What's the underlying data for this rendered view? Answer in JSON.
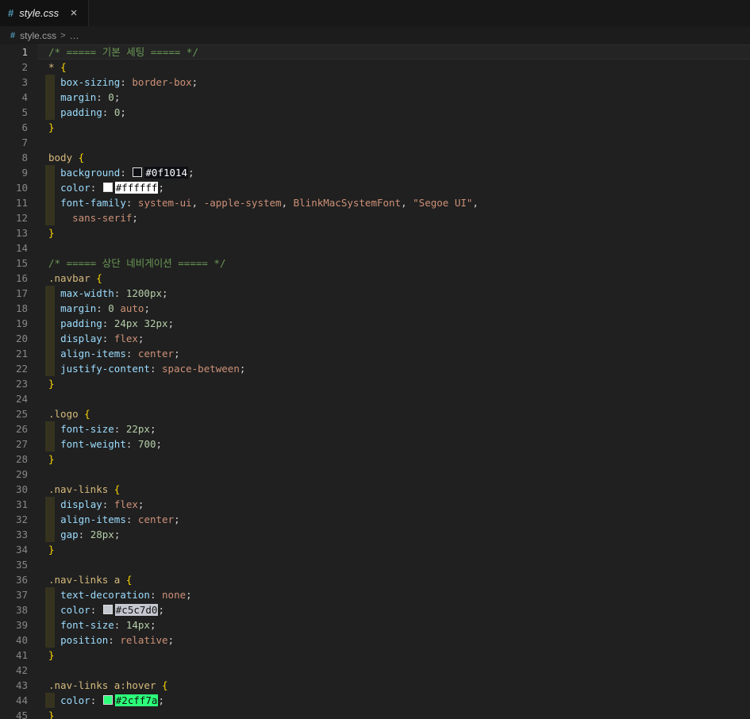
{
  "tab": {
    "title": "style.css",
    "icon_glyph": "#",
    "close_glyph": "×"
  },
  "breadcrumb": {
    "icon_glyph": "#",
    "file": "style.css",
    "separator": ">",
    "ellipsis": "…"
  },
  "theme": {
    "editor_bg": "#202020",
    "tabbar_bg": "#181818",
    "active_tab_bg": "#121212",
    "breadcrumb_bg": "#1c1c1c",
    "css_icon_blue": "#519aba",
    "comment_green": "#6a9955",
    "selector_gold": "#d7ba7d",
    "brace_gold": "#ffd700",
    "property_blue": "#9cdcfe",
    "value_tan": "#ce9178",
    "number_green": "#b5cea8",
    "guide_olive": "#35331f"
  },
  "editor": {
    "active_line": 1,
    "lines": [
      {
        "n": 1,
        "t": [
          [
            "cm",
            "/* ===== 기본 세팅 ===== */"
          ]
        ]
      },
      {
        "n": 2,
        "t": [
          [
            "sel",
            "*"
          ],
          [
            "pn",
            " "
          ],
          [
            "br",
            "{"
          ]
        ]
      },
      {
        "n": 3,
        "g": 1,
        "t": [
          [
            "pn",
            "  "
          ],
          [
            "prop",
            "box-sizing"
          ],
          [
            "pn",
            ": "
          ],
          [
            "val",
            "border-box"
          ],
          [
            "pn",
            ";"
          ]
        ]
      },
      {
        "n": 4,
        "g": 1,
        "t": [
          [
            "pn",
            "  "
          ],
          [
            "prop",
            "margin"
          ],
          [
            "pn",
            ": "
          ],
          [
            "num",
            "0"
          ],
          [
            "pn",
            ";"
          ]
        ]
      },
      {
        "n": 5,
        "g": 1,
        "t": [
          [
            "pn",
            "  "
          ],
          [
            "prop",
            "padding"
          ],
          [
            "pn",
            ": "
          ],
          [
            "num",
            "0"
          ],
          [
            "pn",
            ";"
          ]
        ]
      },
      {
        "n": 6,
        "t": [
          [
            "br",
            "}"
          ]
        ]
      },
      {
        "n": 7,
        "t": []
      },
      {
        "n": 8,
        "t": [
          [
            "sel",
            "body"
          ],
          [
            "pn",
            " "
          ],
          [
            "br",
            "{"
          ]
        ]
      },
      {
        "n": 9,
        "g": 1,
        "t": [
          [
            "pn",
            "  "
          ],
          [
            "prop",
            "background"
          ],
          [
            "pn",
            ": "
          ],
          [
            "chip",
            "#0f1014",
            "#ffffff"
          ],
          [
            "pn",
            ";"
          ]
        ]
      },
      {
        "n": 10,
        "g": 1,
        "t": [
          [
            "pn",
            "  "
          ],
          [
            "prop",
            "color"
          ],
          [
            "pn",
            ": "
          ],
          [
            "chip",
            "#ffffff",
            "#000000"
          ],
          [
            "pn",
            ";"
          ]
        ]
      },
      {
        "n": 11,
        "g": 1,
        "t": [
          [
            "pn",
            "  "
          ],
          [
            "prop",
            "font-family"
          ],
          [
            "pn",
            ": "
          ],
          [
            "val",
            "system-ui"
          ],
          [
            "pn",
            ", "
          ],
          [
            "val",
            "-apple-system"
          ],
          [
            "pn",
            ", "
          ],
          [
            "val",
            "BlinkMacSystemFont"
          ],
          [
            "pn",
            ", "
          ],
          [
            "str",
            "\"Segoe UI\""
          ],
          [
            "pn",
            ","
          ]
        ]
      },
      {
        "n": 12,
        "g": 1,
        "t": [
          [
            "pn",
            "    "
          ],
          [
            "val",
            "sans-serif"
          ],
          [
            "pn",
            ";"
          ]
        ]
      },
      {
        "n": 13,
        "t": [
          [
            "br",
            "}"
          ]
        ]
      },
      {
        "n": 14,
        "t": []
      },
      {
        "n": 15,
        "t": [
          [
            "cm",
            "/* ===== 상단 네비게이션 ===== */"
          ]
        ]
      },
      {
        "n": 16,
        "t": [
          [
            "sel",
            ".navbar"
          ],
          [
            "pn",
            " "
          ],
          [
            "br",
            "{"
          ]
        ]
      },
      {
        "n": 17,
        "g": 1,
        "t": [
          [
            "pn",
            "  "
          ],
          [
            "prop",
            "max-width"
          ],
          [
            "pn",
            ": "
          ],
          [
            "num",
            "1200px"
          ],
          [
            "pn",
            ";"
          ]
        ]
      },
      {
        "n": 18,
        "g": 1,
        "t": [
          [
            "pn",
            "  "
          ],
          [
            "prop",
            "margin"
          ],
          [
            "pn",
            ": "
          ],
          [
            "num",
            "0"
          ],
          [
            "pn",
            " "
          ],
          [
            "val",
            "auto"
          ],
          [
            "pn",
            ";"
          ]
        ]
      },
      {
        "n": 19,
        "g": 1,
        "t": [
          [
            "pn",
            "  "
          ],
          [
            "prop",
            "padding"
          ],
          [
            "pn",
            ": "
          ],
          [
            "num",
            "24px"
          ],
          [
            "pn",
            " "
          ],
          [
            "num",
            "32px"
          ],
          [
            "pn",
            ";"
          ]
        ]
      },
      {
        "n": 20,
        "g": 1,
        "t": [
          [
            "pn",
            "  "
          ],
          [
            "prop",
            "display"
          ],
          [
            "pn",
            ": "
          ],
          [
            "val",
            "flex"
          ],
          [
            "pn",
            ";"
          ]
        ]
      },
      {
        "n": 21,
        "g": 1,
        "t": [
          [
            "pn",
            "  "
          ],
          [
            "prop",
            "align-items"
          ],
          [
            "pn",
            ": "
          ],
          [
            "val",
            "center"
          ],
          [
            "pn",
            ";"
          ]
        ]
      },
      {
        "n": 22,
        "g": 1,
        "t": [
          [
            "pn",
            "  "
          ],
          [
            "prop",
            "justify-content"
          ],
          [
            "pn",
            ": "
          ],
          [
            "val",
            "space-between"
          ],
          [
            "pn",
            ";"
          ]
        ]
      },
      {
        "n": 23,
        "t": [
          [
            "br",
            "}"
          ]
        ]
      },
      {
        "n": 24,
        "t": []
      },
      {
        "n": 25,
        "t": [
          [
            "sel",
            ".logo"
          ],
          [
            "pn",
            " "
          ],
          [
            "br",
            "{"
          ]
        ]
      },
      {
        "n": 26,
        "g": 1,
        "t": [
          [
            "pn",
            "  "
          ],
          [
            "prop",
            "font-size"
          ],
          [
            "pn",
            ": "
          ],
          [
            "num",
            "22px"
          ],
          [
            "pn",
            ";"
          ]
        ]
      },
      {
        "n": 27,
        "g": 1,
        "t": [
          [
            "pn",
            "  "
          ],
          [
            "prop",
            "font-weight"
          ],
          [
            "pn",
            ": "
          ],
          [
            "num",
            "700"
          ],
          [
            "pn",
            ";"
          ]
        ]
      },
      {
        "n": 28,
        "t": [
          [
            "br",
            "}"
          ]
        ]
      },
      {
        "n": 29,
        "t": []
      },
      {
        "n": 30,
        "t": [
          [
            "sel",
            ".nav-links"
          ],
          [
            "pn",
            " "
          ],
          [
            "br",
            "{"
          ]
        ]
      },
      {
        "n": 31,
        "g": 1,
        "t": [
          [
            "pn",
            "  "
          ],
          [
            "prop",
            "display"
          ],
          [
            "pn",
            ": "
          ],
          [
            "val",
            "flex"
          ],
          [
            "pn",
            ";"
          ]
        ]
      },
      {
        "n": 32,
        "g": 1,
        "t": [
          [
            "pn",
            "  "
          ],
          [
            "prop",
            "align-items"
          ],
          [
            "pn",
            ": "
          ],
          [
            "val",
            "center"
          ],
          [
            "pn",
            ";"
          ]
        ]
      },
      {
        "n": 33,
        "g": 1,
        "t": [
          [
            "pn",
            "  "
          ],
          [
            "prop",
            "gap"
          ],
          [
            "pn",
            ": "
          ],
          [
            "num",
            "28px"
          ],
          [
            "pn",
            ";"
          ]
        ]
      },
      {
        "n": 34,
        "t": [
          [
            "br",
            "}"
          ]
        ]
      },
      {
        "n": 35,
        "t": []
      },
      {
        "n": 36,
        "t": [
          [
            "sel",
            ".nav-links"
          ],
          [
            "pn",
            " "
          ],
          [
            "sel",
            "a"
          ],
          [
            "pn",
            " "
          ],
          [
            "br",
            "{"
          ]
        ]
      },
      {
        "n": 37,
        "g": 1,
        "t": [
          [
            "pn",
            "  "
          ],
          [
            "prop",
            "text-decoration"
          ],
          [
            "pn",
            ": "
          ],
          [
            "val",
            "none"
          ],
          [
            "pn",
            ";"
          ]
        ]
      },
      {
        "n": 38,
        "g": 1,
        "t": [
          [
            "pn",
            "  "
          ],
          [
            "prop",
            "color"
          ],
          [
            "pn",
            ": "
          ],
          [
            "chip",
            "#c5c7d0",
            "#141414"
          ],
          [
            "pn",
            ";"
          ]
        ]
      },
      {
        "n": 39,
        "g": 1,
        "t": [
          [
            "pn",
            "  "
          ],
          [
            "prop",
            "font-size"
          ],
          [
            "pn",
            ": "
          ],
          [
            "num",
            "14px"
          ],
          [
            "pn",
            ";"
          ]
        ]
      },
      {
        "n": 40,
        "g": 1,
        "t": [
          [
            "pn",
            "  "
          ],
          [
            "prop",
            "position"
          ],
          [
            "pn",
            ": "
          ],
          [
            "val",
            "relative"
          ],
          [
            "pn",
            ";"
          ]
        ]
      },
      {
        "n": 41,
        "t": [
          [
            "br",
            "}"
          ]
        ]
      },
      {
        "n": 42,
        "t": []
      },
      {
        "n": 43,
        "t": [
          [
            "sel",
            ".nav-links"
          ],
          [
            "pn",
            " "
          ],
          [
            "sel",
            "a:hover"
          ],
          [
            "pn",
            " "
          ],
          [
            "br",
            "{"
          ]
        ]
      },
      {
        "n": 44,
        "g": 1,
        "t": [
          [
            "pn",
            "  "
          ],
          [
            "prop",
            "color"
          ],
          [
            "pn",
            ": "
          ],
          [
            "chip",
            "#2cff7a",
            "#101010"
          ],
          [
            "pn",
            ";"
          ]
        ]
      },
      {
        "n": 45,
        "t": [
          [
            "br",
            "}"
          ]
        ]
      }
    ]
  }
}
